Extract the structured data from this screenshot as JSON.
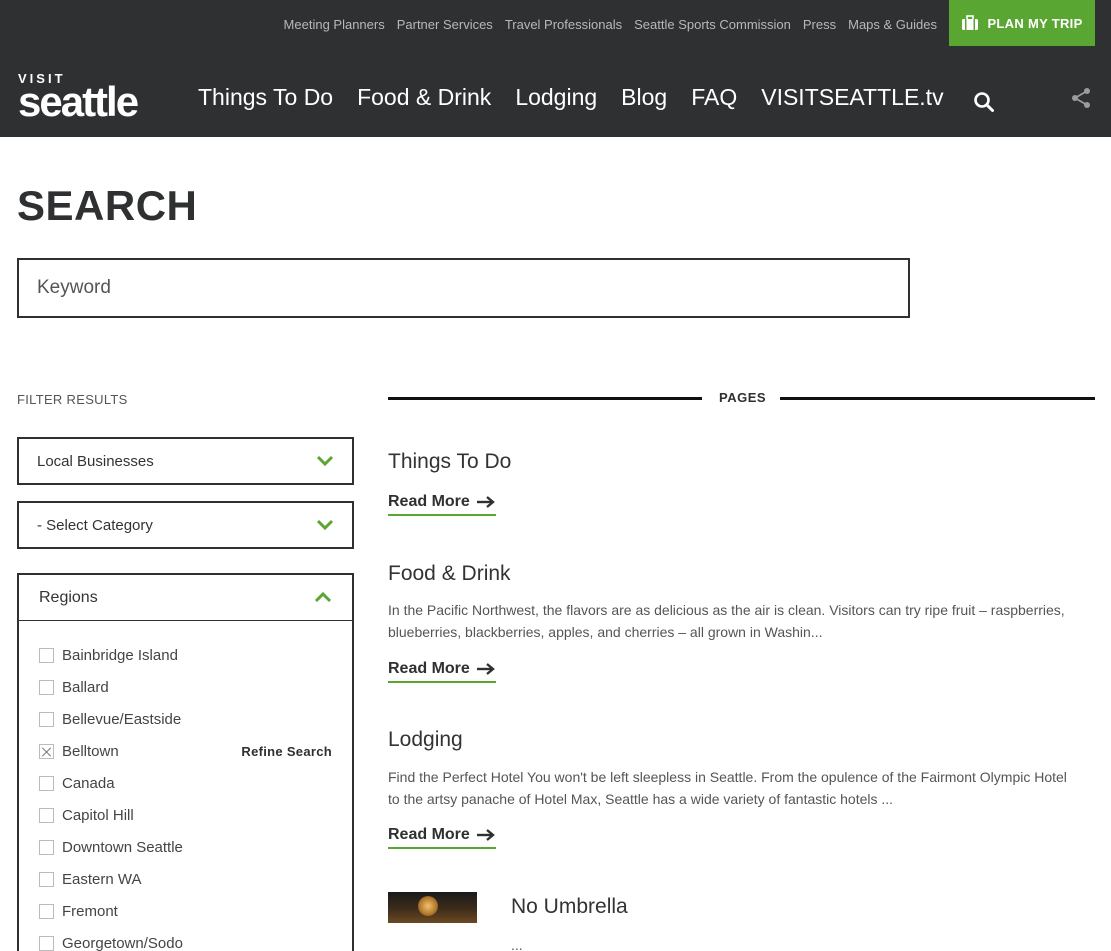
{
  "header": {
    "utility_links": [
      "Meeting Planners",
      "Partner Services",
      "Travel Professionals",
      "Seattle Sports Commission",
      "Press",
      "Maps & Guides"
    ],
    "plan_trip_label": "PLAN MY TRIP",
    "logo": {
      "small": "VISIT",
      "word": "seattle"
    },
    "main_nav": [
      "Things To Do",
      "Food & Drink",
      "Lodging",
      "Blog",
      "FAQ",
      "VISITSEATTLE.tv"
    ],
    "icons": {
      "search": "search-icon",
      "share": "share-icon",
      "suitcase": "suitcase-icon"
    }
  },
  "page": {
    "title": "SEARCH",
    "keyword_placeholder": "Keyword"
  },
  "sidebar": {
    "filter_label": "FILTER RESULTS",
    "type_select": "Local Businesses",
    "category_select": "- Select Category",
    "regions_label": "Regions",
    "refine_label": "Refine Search",
    "regions": [
      {
        "label": "Bainbridge Island",
        "checked": false
      },
      {
        "label": "Ballard",
        "checked": false
      },
      {
        "label": "Bellevue/Eastside",
        "checked": false
      },
      {
        "label": "Belltown",
        "checked": true
      },
      {
        "label": "Canada",
        "checked": false
      },
      {
        "label": "Capitol Hill",
        "checked": false
      },
      {
        "label": "Downtown Seattle",
        "checked": false
      },
      {
        "label": "Eastern WA",
        "checked": false
      },
      {
        "label": "Fremont",
        "checked": false
      },
      {
        "label": "Georgetown/Sodo",
        "checked": false
      }
    ]
  },
  "results": {
    "section_label": "PAGES",
    "read_more_label": "Read More",
    "items": [
      {
        "title": "Things To Do",
        "description": ""
      },
      {
        "title": "Food & Drink",
        "description": "In the Pacific Northwest, the flavors are as delicious as the air is clean. Visitors can try ripe fruit – raspberries, blueberries, blackberries, apples, and cherries – all grown in Washin..."
      },
      {
        "title": "Lodging",
        "description": "Find the Perfect Hotel You won't be left sleepless in Seattle. From the opulence of the Fairmont Olympic Hotel to the artsy panache of Hotel Max, Seattle has a wide variety of fantastic hotels ..."
      },
      {
        "title": "No Umbrella",
        "description": "..."
      }
    ]
  },
  "colors": {
    "header_bg": "#2e3031",
    "accent_green": "#5aa632"
  }
}
